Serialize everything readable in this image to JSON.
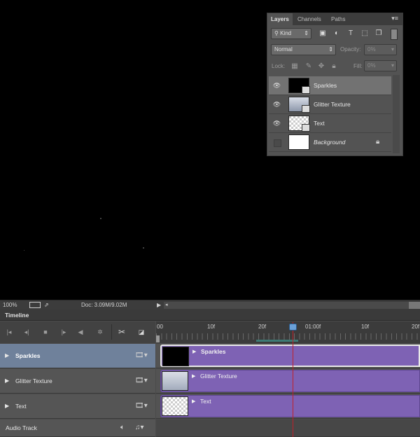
{
  "layers_panel": {
    "tabs": [
      "Layers",
      "Channels",
      "Paths"
    ],
    "filter_kind": "Kind",
    "blend_mode": "Normal",
    "opacity_label": "Opacity:",
    "opacity_value": "0%",
    "lock_label": "Lock:",
    "fill_label": "Fill:",
    "fill_value": "0%",
    "layers": [
      {
        "name": "Sparkles",
        "visible": true,
        "selected": true
      },
      {
        "name": "Glitter Texture",
        "visible": true,
        "selected": false
      },
      {
        "name": "Text",
        "visible": true,
        "selected": false
      },
      {
        "name": "Background",
        "visible": false,
        "selected": false,
        "locked": true
      }
    ]
  },
  "status_bar": {
    "zoom": "100%",
    "doc": "Doc: 3.09M/9.02M"
  },
  "timeline": {
    "title": "Timeline",
    "ruler_labels": [
      "00",
      "10f",
      "20f",
      "01:00f",
      "10f",
      "20f"
    ],
    "tracks": [
      {
        "name": "Sparkles",
        "clip": "Sparkles",
        "selected": true
      },
      {
        "name": "Glitter Texture",
        "clip": "Glitter Texture",
        "selected": false
      },
      {
        "name": "Text",
        "clip": "Text",
        "selected": false
      }
    ],
    "audio_track": "Audio Track"
  },
  "icons": {
    "eye": "eye-icon",
    "lock": "lock-icon",
    "film": "film-strip-icon",
    "scissors": "scissors-icon",
    "audio": "speaker-icon",
    "music": "music-note-icon"
  },
  "colors": {
    "clip": "#7e62b4",
    "selected_track": "#6f819b",
    "playhead": "#c0202a"
  }
}
